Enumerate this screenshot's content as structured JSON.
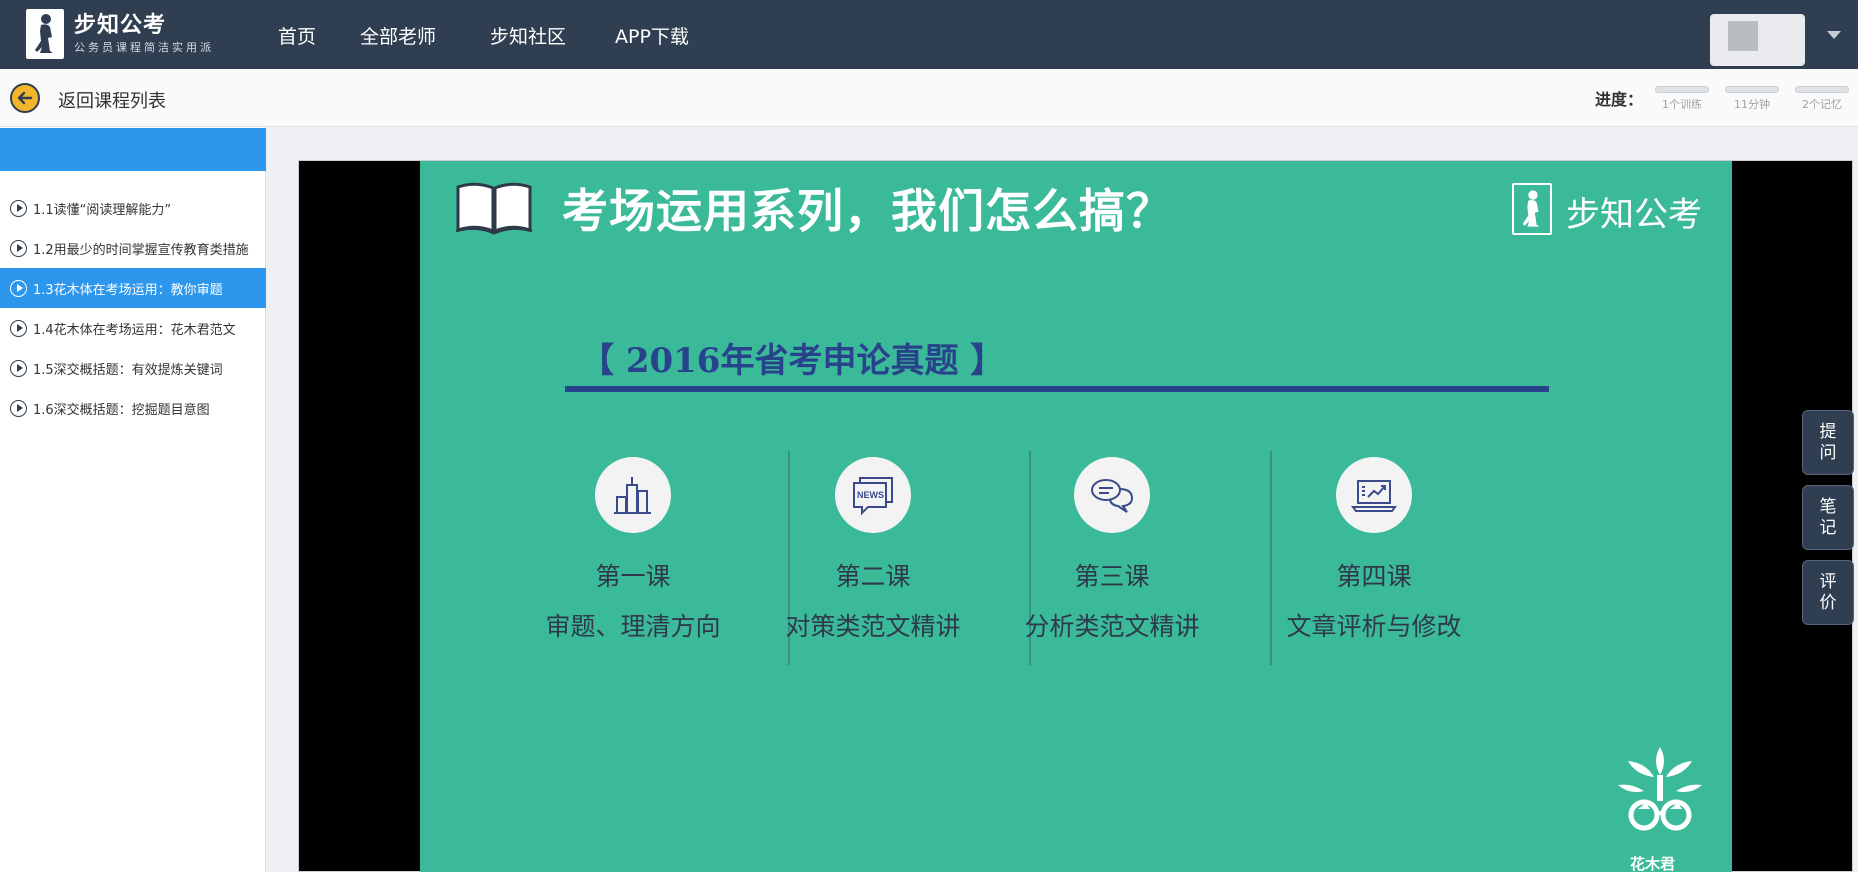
{
  "header": {
    "brand_name": "步知公考",
    "brand_slogan": "公务员课程简洁实用派",
    "nav": [
      "首页",
      "全部老师",
      "步知社区",
      "APP下载"
    ]
  },
  "subbar": {
    "back_label": "返回课程列表",
    "progress_label": "进度：",
    "progress_items": [
      {
        "label": "1个训练",
        "fraction": 0
      },
      {
        "label": "11分钟",
        "fraction": 0
      },
      {
        "label": "2个记忆",
        "fraction": 0
      }
    ]
  },
  "sidebar": {
    "lessons": [
      {
        "label": "1.1读懂“阅读理解能力”",
        "active": false
      },
      {
        "label": "1.2用最少的时间掌握宣传教育类措施",
        "active": false
      },
      {
        "label": "1.3花木体在考场运用：教你审题",
        "active": true
      },
      {
        "label": "1.4花木体在考场运用：花木君范文",
        "active": false
      },
      {
        "label": "1.5深交概括题：有效提炼关键词",
        "active": false
      },
      {
        "label": "1.6深交概括题：挖掘题目意图",
        "active": false
      }
    ]
  },
  "slide": {
    "title": "考场运用系列，我们怎么搞？",
    "brand": "步知公考",
    "exam_title": "【 2016年省考申论真题 】",
    "columns": [
      {
        "icon": "city-buildings-icon",
        "num": "第一课",
        "desc": "审题、理清方向"
      },
      {
        "icon": "news-icon",
        "num": "第二课",
        "desc": "对策类范文精讲"
      },
      {
        "icon": "chat-bubbles-icon",
        "num": "第三课",
        "desc": "分析类范文精讲"
      },
      {
        "icon": "laptop-chart-icon",
        "num": "第四课",
        "desc": "文章评析与修改"
      }
    ],
    "mascot_name": "花木君"
  },
  "float_buttons": [
    "提\n问",
    "笔\n记",
    "评\n价"
  ],
  "colors": {
    "header_bg": "#2f3e50",
    "accent_blue": "#2d96ed",
    "slide_green": "#3bba9a",
    "exam_blue": "#28438c"
  }
}
